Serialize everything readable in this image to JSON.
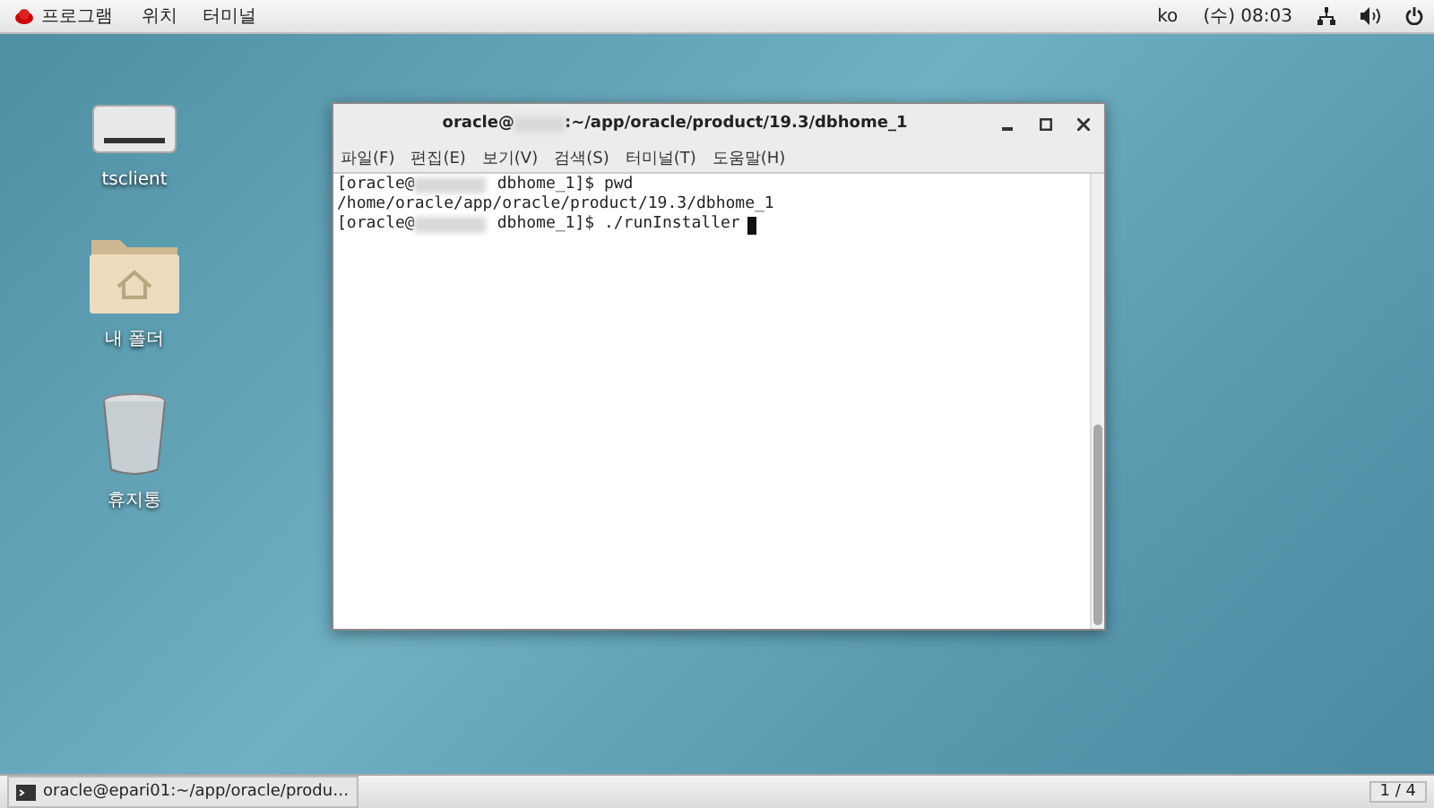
{
  "top_bar": {
    "menus": [
      "프로그램",
      "위치",
      "터미널"
    ],
    "language": "ko",
    "clock": "(수) 08:03"
  },
  "desktop_icons": [
    {
      "label": "tsclient",
      "kind": "drive"
    },
    {
      "label": "내 폴더",
      "kind": "folder"
    },
    {
      "label": "휴지통",
      "kind": "trash"
    }
  ],
  "terminal": {
    "title_prefix": "oracle@",
    "title_suffix": ":~/app/oracle/product/19.3/dbhome_1",
    "menus": [
      "파일(F)",
      "편집(E)",
      "보기(V)",
      "검색(S)",
      "터미널(T)",
      "도움말(H)"
    ],
    "lines": [
      {
        "kind": "prompt",
        "user": "[oracle@",
        "rest": "dbhome_1]$ pwd",
        "cursor": false
      },
      {
        "kind": "output",
        "text": "/home/oracle/app/oracle/product/19.3/dbhome_1"
      },
      {
        "kind": "prompt",
        "user": "[oracle@",
        "rest": "dbhome_1]$ ./runInstaller",
        "cursor": true
      }
    ]
  },
  "taskbar": {
    "task": "oracle@epari01:~/app/oracle/produ…",
    "workspace": "1 / 4"
  }
}
